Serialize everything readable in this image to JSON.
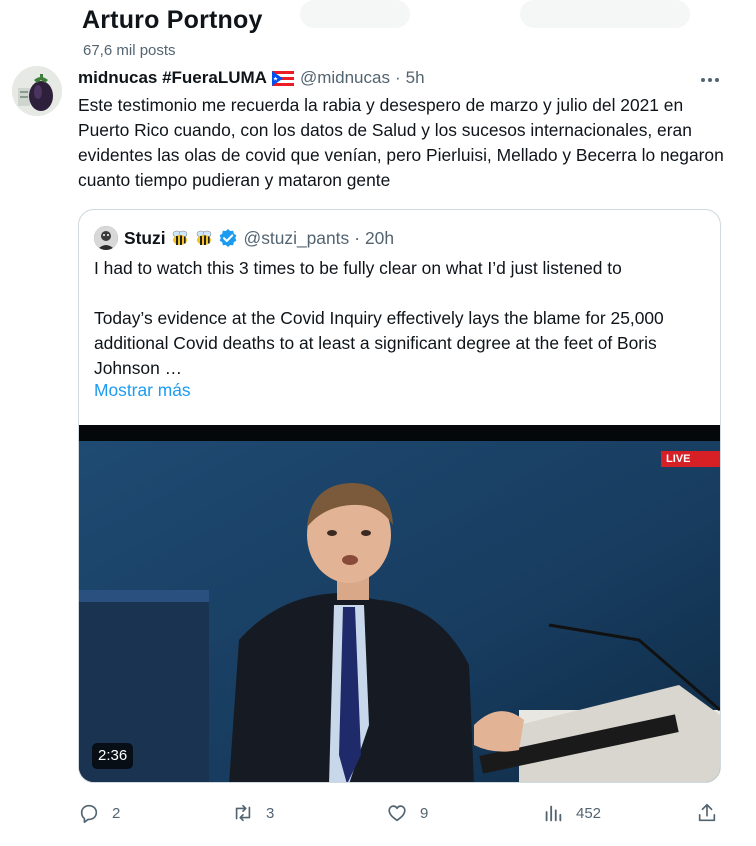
{
  "profile": {
    "name": "Arturo Portnoy",
    "post_count": "67,6 mil posts"
  },
  "tweet": {
    "display_name": "midnucas #FueraLUMA",
    "handle": "@midnucas",
    "separator": "·",
    "time": "5h",
    "text": "Este testimonio me recuerda la rabia y desespero de marzo y julio del 2021 en Puerto Rico cuando, con los datos de Salud y los sucesos internacionales, eran evidentes las olas de covid que venían, pero Pierluisi, Mellado y Becerra lo negaron cuanto tiempo pudieran y mataron gente"
  },
  "quote": {
    "display_name": "Stuzi",
    "handle": "@stuzi_pants",
    "separator": "·",
    "time": "20h",
    "paragraphs": [
      "I had to watch this 3 times to be fully clear on what I’d just listened to",
      "Today’s evidence at the Covid Inquiry effectively lays the blame for 25,000 additional Covid deaths to at least a significant degree at the feet of Boris Johnson …"
    ],
    "show_more": "Mostrar más",
    "video": {
      "live_label": "LIVE",
      "duration": "2:36"
    }
  },
  "actions": {
    "reply_count": "2",
    "repost_count": "3",
    "like_count": "9",
    "view_count": "452"
  },
  "colors": {
    "text_primary": "#0f1419",
    "text_secondary": "#536471",
    "link_blue": "#1d9bf0",
    "verified_blue": "#1d9bf0",
    "live_red": "#d71f26",
    "border": "#cfd9de"
  },
  "icons": {
    "more": "more-horizontal-icon",
    "reply": "reply-icon",
    "repost": "repost-icon",
    "like": "heart-icon",
    "views": "views-icon",
    "share": "share-icon",
    "verified": "verified-badge-icon",
    "flag": "puerto-rico-flag-icon",
    "bee": "bee-emoji-icon"
  }
}
